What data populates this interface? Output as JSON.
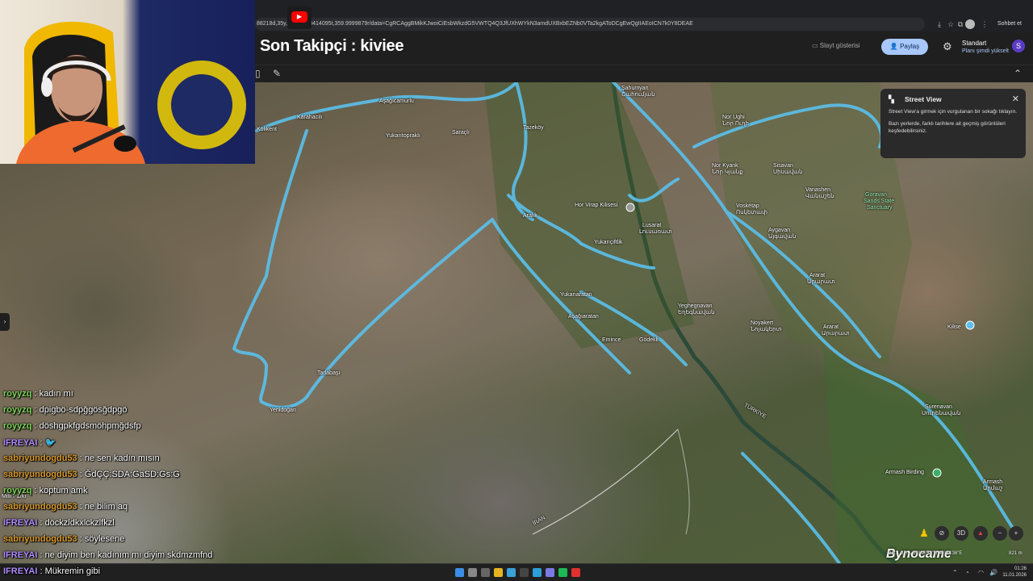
{
  "browser": {
    "url": "88218d,35y,...,72h,0.8414095t,359.9999879r/data=CgRCAggBMikKJwoiCiEsbWkzdG5VWTQ4Q3JfUXhWYkN3amdUXBxbEZNb0VTa2kgAToDCgEwQgIIAEoICN7k0Y8DEAE",
    "chat_button": "Sohbet et"
  },
  "header": {
    "stream_title": "Son Takipçi : kiviee",
    "slideshow_label": "Slayt gösterisi",
    "share_label": "Paylaş",
    "plan_name": "Standart",
    "plan_upgrade": "Planı şimdi yükselt",
    "user_initial": "S"
  },
  "street_view": {
    "title": "Street View",
    "text1": "Street View'a girmek için vurgulanan bir sokağı tıklayın.",
    "text2": "Bazı yerlerde, farklı tarihlere ait geçmiş görüntüleri keşfedebilirsiniz."
  },
  "places": [
    {
      "name": "Şahumyan"
    },
    {
      "name": "Շահումյան"
    },
    {
      "name": "Aşağıcamurlu"
    },
    {
      "name": "Karahacılı"
    },
    {
      "name": "Kolikent"
    },
    {
      "name": "Yukarıtopraklı"
    },
    {
      "name": "Saraçlı"
    },
    {
      "name": "Tazeköy"
    },
    {
      "name": "Nor Ughi"
    },
    {
      "name": "Նոր Ուղի"
    },
    {
      "name": "Nor Kyank"
    },
    {
      "name": "Նոր Կյանք"
    },
    {
      "name": "Sisavan"
    },
    {
      "name": "Սիսավան"
    },
    {
      "name": "Vanashen"
    },
    {
      "name": "Վանաշեն"
    },
    {
      "name": "Goravan"
    },
    {
      "name": "Sands State"
    },
    {
      "name": "Sanctuary"
    },
    {
      "name": "Hor Virap Kilisesi"
    },
    {
      "name": "Aralık"
    },
    {
      "name": "Voskétap"
    },
    {
      "name": "Ոսկետափ"
    },
    {
      "name": "Lusarat"
    },
    {
      "name": "Լուսառատ"
    },
    {
      "name": "Aygavan"
    },
    {
      "name": "Այգավան"
    },
    {
      "name": "Yukarıçiftlik"
    },
    {
      "name": "Ararat"
    },
    {
      "name": "Արարատ"
    },
    {
      "name": "Yukarıaratan"
    },
    {
      "name": "Yeghegnavan"
    },
    {
      "name": "Եղեգնավան"
    },
    {
      "name": "Aşağıaratan"
    },
    {
      "name": "Noyakert"
    },
    {
      "name": "Նոյակերտ"
    },
    {
      "name": "Ararat"
    },
    {
      "name": "Արարատ"
    },
    {
      "name": "Emince"
    },
    {
      "name": "Gödekli"
    },
    {
      "name": "Kilise"
    },
    {
      "name": "Tarlabaşı"
    },
    {
      "name": "Yenidoğan"
    },
    {
      "name": "Surenavan"
    },
    {
      "name": "Սուրենավան"
    },
    {
      "name": "Armash Birding"
    },
    {
      "name": "Armash"
    },
    {
      "name": "Արմաշ"
    },
    {
      "name": "TÜRKİYE"
    },
    {
      "name": "İRAN"
    },
    {
      "name": "Milli Parkı"
    }
  ],
  "chat": {
    "messages": [
      {
        "user": "royyzq",
        "text": ": kadın mı",
        "color": "#7fd35a"
      },
      {
        "user": "royyzq",
        "text": ": dpigbö-sdpğgösğdpgö",
        "color": "#7fd35a"
      },
      {
        "user": "royyzq",
        "text": ": döshgpkfgdsmöhpmğdsfp",
        "color": "#7fd35a"
      },
      {
        "user": "IFREYAI",
        "text": ":",
        "color": "#b08cff"
      },
      {
        "user": "sabriyundogdu53",
        "text": ": ne sen kadın mısın",
        "color": "#d99a2e"
      },
      {
        "user": "sabriyundogdu53",
        "text": ": ĞdÇÇ:SDA:GaSD:Gs:G",
        "color": "#d99a2e"
      },
      {
        "user": "royyzq",
        "text": ": koptum amk",
        "color": "#7fd35a"
      },
      {
        "user": "sabriyundogdu53",
        "text": ": ne bilim aq",
        "color": "#d99a2e"
      },
      {
        "user": "IFREYAI",
        "text": ": döckzldkxlckzlfkzl",
        "color": "#b08cff"
      },
      {
        "user": "sabriyundogdu53",
        "text": ": söylesene",
        "color": "#d99a2e"
      },
      {
        "user": "IFREYAI",
        "text": ": ne diyim ben kadınım mı diyim skdmzmfnd",
        "color": "#b08cff"
      },
      {
        "user": "IFREYAI",
        "text": ": Mükremin gibi",
        "color": "#b08cff"
      }
    ]
  },
  "map_controls": {
    "mode_3d": "3D",
    "scale": "821 m",
    "coords": "Dat... 3 h... 39°48'54\"N 44°34'36\"E",
    "watermark": "Bynocame"
  },
  "taskbar": {
    "time": "01:26",
    "date": "11.01.2026"
  },
  "colors": {
    "street_view_overlay": "#5bc0eb",
    "share_button": "#a8c7fa",
    "avatar": "#5b3cc4"
  }
}
